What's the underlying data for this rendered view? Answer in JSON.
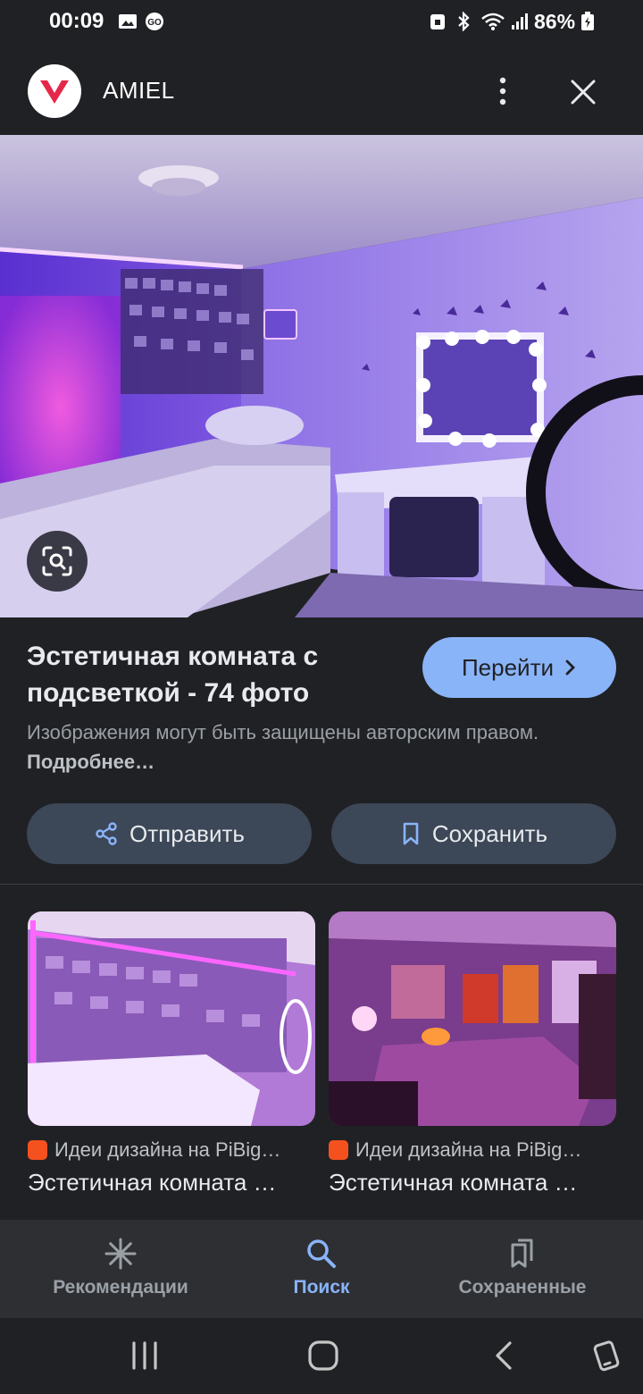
{
  "status_bar": {
    "time": "00:09",
    "battery": "86%",
    "icons": [
      "gallery-icon",
      "go-icon",
      "lock-icon",
      "bluetooth-icon",
      "wifi-icon",
      "signal-icon",
      "battery-icon"
    ]
  },
  "header": {
    "site_name": "AMIEL",
    "icons": [
      "site-logo-icon",
      "more-vert-icon",
      "close-icon"
    ]
  },
  "result": {
    "title": "Эстетичная комната с подсветкой - 74 фото",
    "goto_label": "Перейти",
    "copyright_text": "Изображения могут быть защищены авторским правом.",
    "learn_more": "Подробнее…",
    "share_label": "Отправить",
    "save_label": "Сохранить"
  },
  "related": [
    {
      "source": "Идеи дизайна на PiBig…",
      "title": "Эстетичная комната …"
    },
    {
      "source": "Идеи дизайна на PiBig…",
      "title": "Эстетичная комната …"
    }
  ],
  "bottom_nav": {
    "items": [
      {
        "label": "Рекомендации",
        "icon": "sparkle-icon"
      },
      {
        "label": "Поиск",
        "icon": "search-icon"
      },
      {
        "label": "Сохраненные",
        "icon": "collections-icon"
      }
    ],
    "active": "Поиск"
  },
  "colors": {
    "background": "#202124",
    "accent": "#8ab4f8",
    "button_bg": "#3c4757",
    "nav_bg": "#2d2f33"
  }
}
